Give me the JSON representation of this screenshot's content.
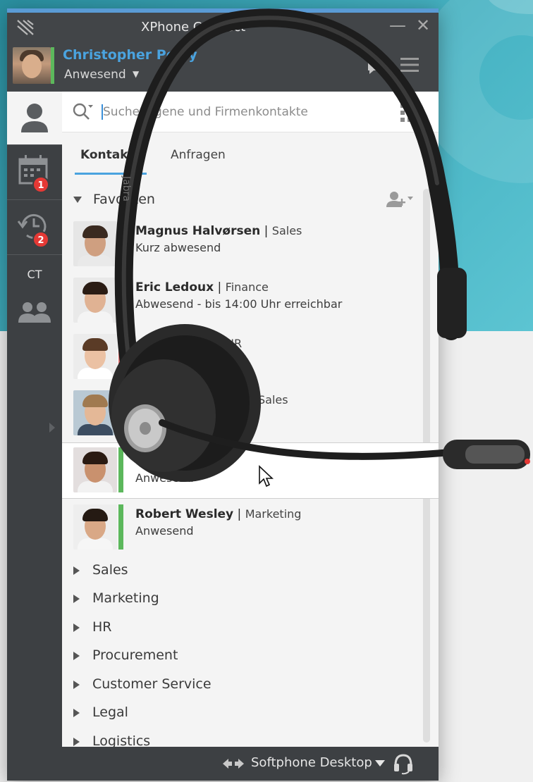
{
  "window": {
    "title": "XPhone Connect",
    "minimize_icon": "minimize-icon",
    "close_icon": "close-icon",
    "accent_color": "#5a9bd5"
  },
  "user": {
    "name": "Christopher Perry",
    "status": "Anwesend",
    "status_color": "#5cb85c",
    "name_color": "#4aa3df"
  },
  "sidebar": {
    "items": [
      {
        "name": "contacts",
        "icon": "person-icon"
      },
      {
        "name": "calendar",
        "icon": "calendar-icon",
        "badge": "1"
      },
      {
        "name": "history",
        "icon": "history-icon",
        "badge": "2"
      },
      {
        "name": "ct",
        "label": "CT"
      },
      {
        "name": "groups",
        "icon": "group-icon"
      }
    ]
  },
  "search": {
    "placeholder": "Suche Eigene und Firmenkontakte"
  },
  "tabs": [
    {
      "label": "Kontakte",
      "active": true
    },
    {
      "label": "Anfragen",
      "active": false
    }
  ],
  "favorites": {
    "label": "Favoriten",
    "contacts": [
      {
        "name": "Magnus Halvørsen",
        "dept": "Sales",
        "status": "Kurz abwesend",
        "status_color": "#f0c419"
      },
      {
        "name": "Eric Ledoux",
        "dept": "Finance",
        "status": "Abwesend - bis 14:00 Uhr erreichbar",
        "status_color": "#5cb85c"
      },
      {
        "name": "",
        "dept": "HR",
        "status": "",
        "status_color": "#e57373"
      },
      {
        "name": "",
        "dept": "Sales",
        "status": "",
        "status_color": "#5cb85c"
      },
      {
        "name": "",
        "dept": "",
        "status": "Anwesend",
        "status_color": "#5cb85c"
      },
      {
        "name": "Robert Wesley",
        "dept": "Marketing",
        "status": "Anwesend",
        "status_color": "#5cb85c"
      }
    ]
  },
  "groups": [
    "Sales",
    "Marketing",
    "HR",
    "Procurement",
    "Customer Service",
    "Legal",
    "Logistics"
  ],
  "footer": {
    "softphone_label": "Softphone Desktop"
  }
}
